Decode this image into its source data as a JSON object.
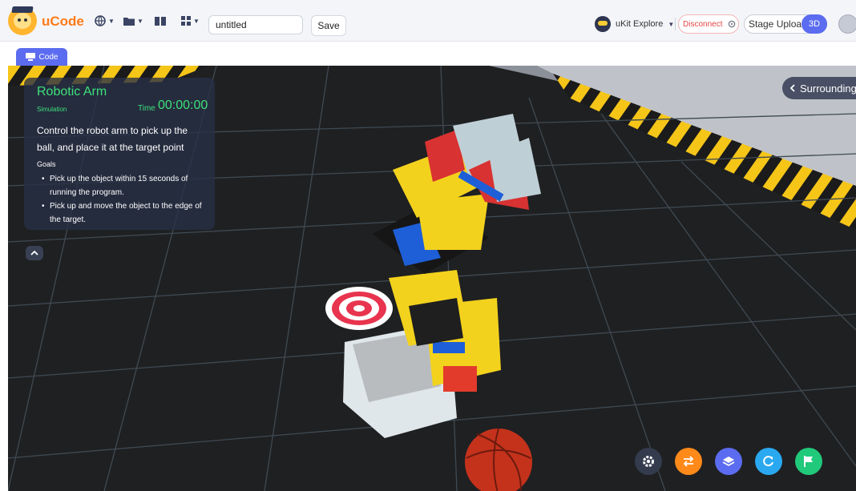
{
  "app": {
    "brand": "uCode"
  },
  "toolbar": {
    "project_name": "untitled",
    "save_label": "Save"
  },
  "device": {
    "name": "uKit Explore",
    "disconnect_label": "Disconnect",
    "stage_upload_label": "Stage Upload",
    "mode_badge": "3D"
  },
  "tabs": [
    {
      "label": "Code"
    }
  ],
  "task": {
    "title": "Robotic Arm",
    "subtitle": "Simulation",
    "time_label": "Time",
    "time_value": "00:00:00",
    "description": "Control the robot arm to pick up the ball, and place it at the target point",
    "goals_label": "Goals",
    "goals": [
      "Pick up the object within 15 seconds of running the program.",
      "Pick up and move the object to the edge of the target."
    ]
  },
  "scene": {
    "surroundings_label": "Surroundings"
  },
  "controls": [
    {
      "icon": "gear-icon",
      "color": "#333b4d"
    },
    {
      "icon": "swap-icon",
      "color": "#ff8a1a"
    },
    {
      "icon": "layers-icon",
      "color": "#5b6cf0"
    },
    {
      "icon": "reset-icon",
      "color": "#2aa9f0"
    },
    {
      "icon": "flag-icon",
      "color": "#21c97a"
    }
  ]
}
